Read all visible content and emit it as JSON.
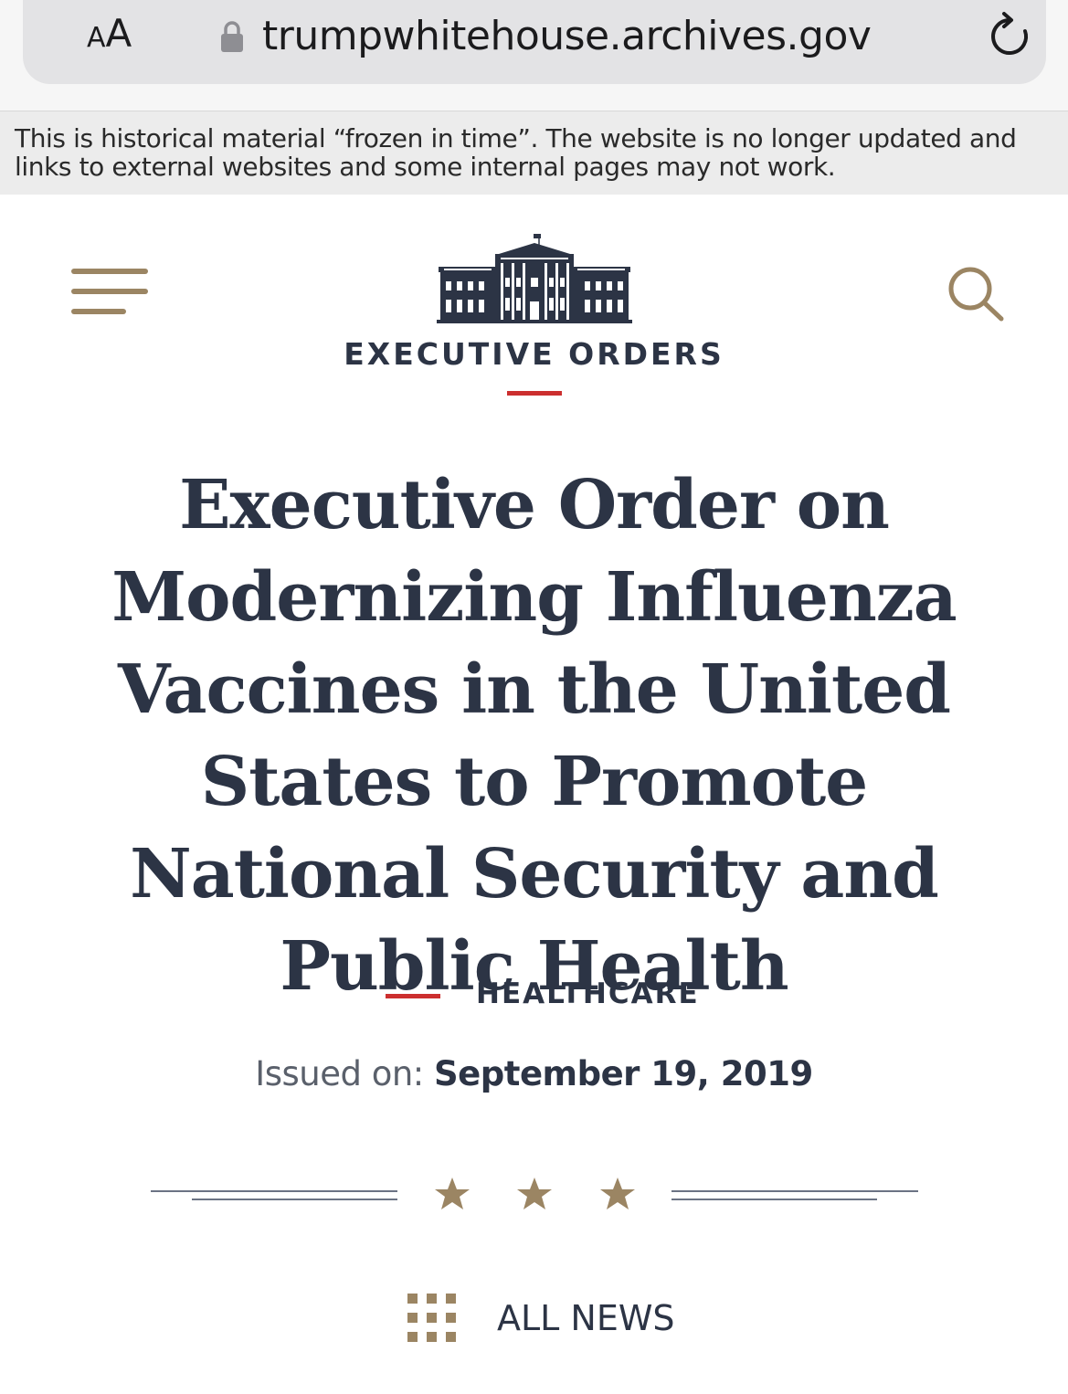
{
  "browser": {
    "text_size_small": "A",
    "text_size_large": "A",
    "url": "trumpwhitehouse.archives.gov"
  },
  "notice": {
    "text": "This is historical material “frozen in time”. The website is no longer updated and links to external websites and some internal pages may not work."
  },
  "header": {
    "section": "EXECUTIVE ORDERS"
  },
  "article": {
    "title": "Executive Order on Modernizing Influenza Vaccines in the United States to Promote National Security and Public Health",
    "category": "HEALTHCARE",
    "issued_label": "Issued on:",
    "issued_date": "September 19, 2019"
  },
  "footer_nav": {
    "all_news": "ALL NEWS"
  },
  "colors": {
    "navy": "#2c3445",
    "gold": "#9b8563",
    "accent_red": "#cc2f2f",
    "notice_bg": "#ececec"
  },
  "icons": [
    "lock-icon",
    "reload-icon",
    "menu-icon",
    "white-house-logo",
    "search-icon",
    "star-icon",
    "grid-icon"
  ]
}
